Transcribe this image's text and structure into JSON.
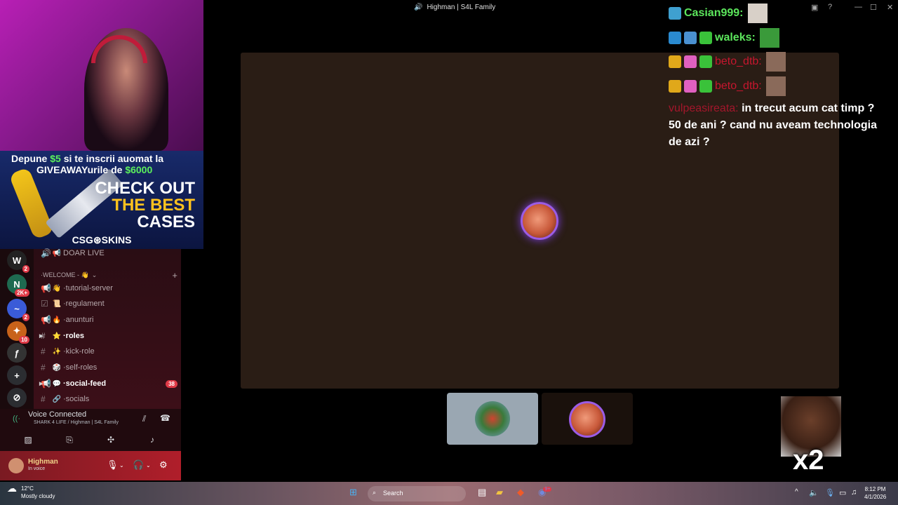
{
  "window": {
    "title": "Highman | S4L Family"
  },
  "ad": {
    "line1_a": "Depune ",
    "line1_amount": "$5",
    "line1_b": " si te inscrii auomat la",
    "line2_a": "GIVEAWAYurile de ",
    "line2_amount": "$6000",
    "big1": "CHECK OUT",
    "big2": "THE BEST",
    "big3": "CASES",
    "logo": "CSG⊛SKINS"
  },
  "servers": [
    {
      "label": "W",
      "badge": "2"
    },
    {
      "label": "N",
      "badge": "2K+"
    },
    {
      "label": "~",
      "badge": "2"
    },
    {
      "label": "✦",
      "badge": "10"
    },
    {
      "label": "ƒ",
      "badge": ""
    }
  ],
  "channels": {
    "doar_live": "DOAR LIVE",
    "category": "WELCOME - 👋",
    "items": [
      {
        "name": "tutorial-server",
        "emoji": "👋",
        "icon": "megaphone-icon"
      },
      {
        "name": "regulament",
        "emoji": "📜",
        "icon": "rules-icon"
      },
      {
        "name": "anunturi",
        "emoji": "🔥",
        "icon": "megaphone-icon"
      },
      {
        "name": "roles",
        "emoji": "⭐",
        "icon": "hash-icon",
        "bold": true
      },
      {
        "name": "kick-role",
        "emoji": "✨",
        "icon": "hash-icon"
      },
      {
        "name": "self-roles",
        "emoji": "🎲",
        "icon": "hash-icon"
      },
      {
        "name": "social-feed",
        "emoji": "💬",
        "icon": "megaphone-icon",
        "bold": true,
        "count": "38"
      },
      {
        "name": "socials",
        "emoji": "🔗",
        "icon": "hash-icon"
      }
    ]
  },
  "voice": {
    "status": "Voice Connected",
    "location": "SHARK 4 LIFE / Highman | S4L Family"
  },
  "user": {
    "name": "Highman",
    "status": "In voice"
  },
  "chat": {
    "messages": [
      {
        "user": "Casian999:",
        "color": "#5ce65c"
      },
      {
        "user": "waleks:",
        "color": "#5ce65c"
      },
      {
        "user": "beto_dtb:",
        "color": "#c7162e"
      },
      {
        "user": "beto_dtb:",
        "color": "#c7162e"
      }
    ],
    "last_user": "vulpeasireata:",
    "last_text": " in trecut acum cat timp ? 50 de ani ? cand nu aveam technologia de azi ?"
  },
  "overlay": {
    "multiplier": "x2"
  },
  "taskbar": {
    "temp": "12°C",
    "weather": "Mostly cloudy",
    "search": "Search",
    "time": "8:12 PM",
    "date": "4/1/2026",
    "discord_badge": "9+"
  }
}
